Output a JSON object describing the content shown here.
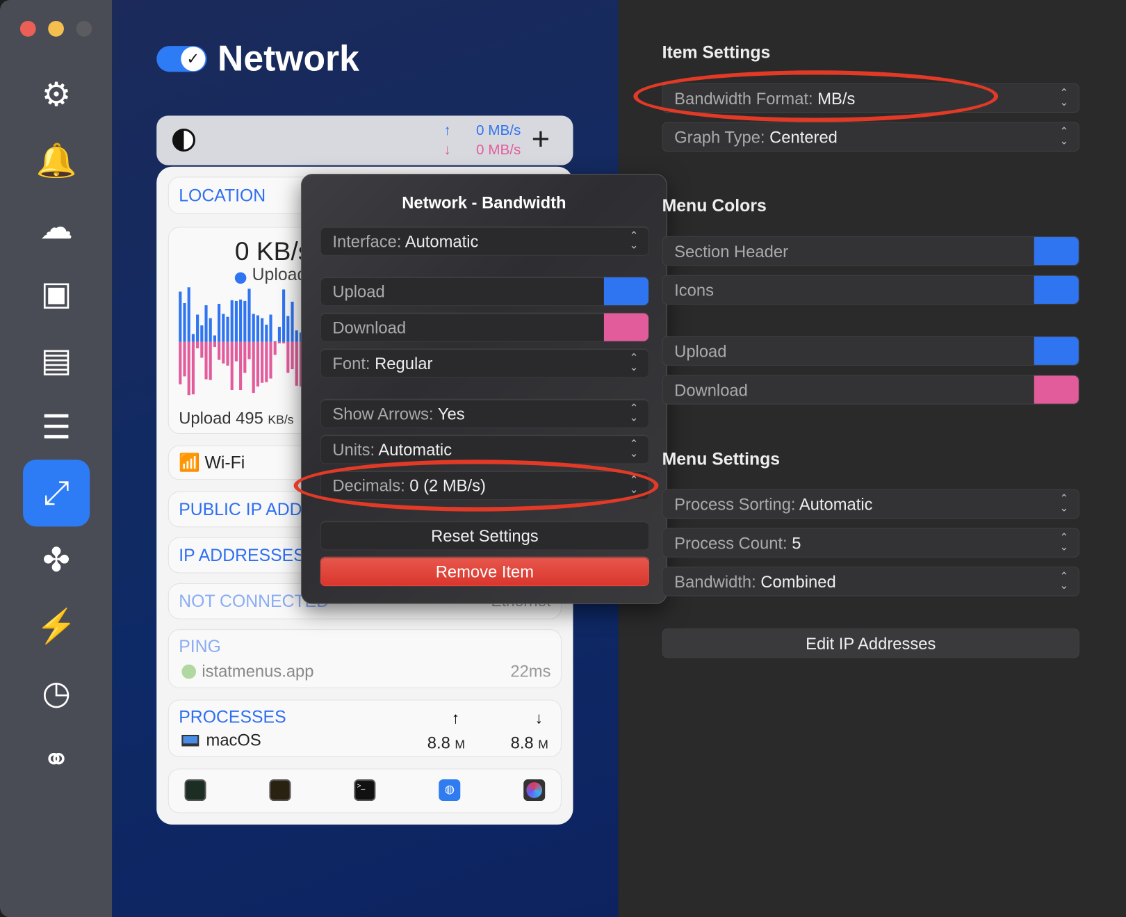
{
  "window": {
    "lights": [
      "#ec5f57",
      "#f4bf4f",
      "#5b5c60"
    ]
  },
  "sidebar": {
    "items": [
      {
        "icon": "gear-icon",
        "glyph": "⚙"
      },
      {
        "icon": "bell-icon",
        "glyph": "🔔"
      },
      {
        "icon": "cloud-icon",
        "glyph": "☁"
      },
      {
        "icon": "cpu-icon",
        "glyph": "▣"
      },
      {
        "icon": "memory-icon",
        "glyph": "▤"
      },
      {
        "icon": "disk-icon",
        "glyph": "☰"
      },
      {
        "icon": "network-icon",
        "glyph": "⤢",
        "active": true
      },
      {
        "icon": "fan-icon",
        "glyph": "✤"
      },
      {
        "icon": "battery-bolt-icon",
        "glyph": "⚡"
      },
      {
        "icon": "clock-icon",
        "glyph": "◷"
      },
      {
        "icon": "combined-icon",
        "glyph": "⚭"
      }
    ]
  },
  "header": {
    "title": "Network",
    "enabled": true
  },
  "menubar_preview": {
    "upload": "0 MB/s",
    "download": "0 MB/s",
    "up_arrow": "↑",
    "down_arrow": "↓",
    "add": "+"
  },
  "card": {
    "location": "LOCATION",
    "speed": "0 KB/s",
    "legend_upload": "Upload",
    "upload_footer_label": "Upload",
    "upload_footer_value": "495",
    "upload_footer_unit": "KB/s",
    "graph": {
      "upload": [
        70,
        54,
        76,
        11,
        38,
        23,
        51,
        33,
        9,
        53,
        39,
        35,
        58,
        57,
        59,
        57,
        74,
        39,
        37,
        33,
        24,
        38,
        1,
        21,
        73,
        36,
        56,
        16,
        13,
        62
      ],
      "download": [
        59,
        48,
        74,
        73,
        9,
        22,
        52,
        53,
        7,
        25,
        30,
        33,
        67,
        27,
        67,
        43,
        24,
        71,
        62,
        57,
        56,
        51,
        18,
        2,
        2,
        43,
        38,
        61,
        62,
        29
      ],
      "upload_color": "#2f74f0",
      "download_color": "#e25c9c"
    },
    "wifi": "Wi-Fi",
    "public_ip": "PUBLIC IP ADDRESSES",
    "ip_addresses": "IP ADDRESSES",
    "not_connected": "NOT CONNECTED",
    "ethernet": "Ethernet",
    "ping": {
      "title": "PING",
      "host": "istatmenus.app",
      "value": "22ms"
    },
    "processes": {
      "title": "PROCESSES",
      "up": "↑",
      "down": "↓",
      "name": "macOS",
      "up_val": "8.8",
      "down_val": "8.8",
      "unit": "M"
    },
    "apps": [
      "activity-monitor-icon",
      "console-icon",
      "terminal-icon",
      "network-utility-icon",
      "istat-icon"
    ]
  },
  "popover": {
    "title": "Network - Bandwidth",
    "interface": {
      "label": "Interface:",
      "value": "Automatic"
    },
    "upload": {
      "label": "Upload",
      "color": "#2f74f0"
    },
    "download": {
      "label": "Download",
      "color": "#e25c9c"
    },
    "font": {
      "label": "Font:",
      "value": "Regular"
    },
    "arrows": {
      "label": "Show Arrows:",
      "value": "Yes"
    },
    "units": {
      "label": "Units:",
      "value": "Automatic"
    },
    "decimals": {
      "label": "Decimals:",
      "value": "0 (2 MB/s)"
    },
    "reset": "Reset Settings",
    "remove": "Remove Item"
  },
  "right": {
    "item_settings": "Item Settings",
    "bandwidth_format": {
      "label": "Bandwidth Format:",
      "value": "MB/s"
    },
    "graph_type": {
      "label": "Graph Type:",
      "value": "Centered"
    },
    "menu_colors": "Menu Colors",
    "section_header": {
      "label": "Section Header",
      "color": "#2f74f0"
    },
    "icons": {
      "label": "Icons",
      "color": "#2f74f0"
    },
    "upload": {
      "label": "Upload",
      "color": "#2f74f0"
    },
    "download": {
      "label": "Download",
      "color": "#e25c9c"
    },
    "menu_settings": "Menu Settings",
    "process_sorting": {
      "label": "Process Sorting:",
      "value": "Automatic"
    },
    "process_count": {
      "label": "Process Count:",
      "value": "5"
    },
    "bandwidth": {
      "label": "Bandwidth:",
      "value": "Combined"
    },
    "edit_ip": "Edit IP Addresses"
  },
  "annotation_color": "#e23a26"
}
